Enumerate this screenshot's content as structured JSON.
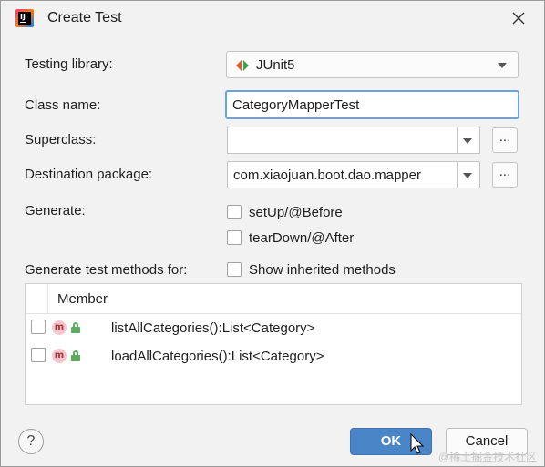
{
  "window": {
    "title": "Create Test"
  },
  "form": {
    "testing_library_label": "Testing library:",
    "testing_library_value": "JUnit5",
    "class_name_label": "Class name:",
    "class_name_value": "CategoryMapperTest",
    "superclass_label": "Superclass:",
    "superclass_value": "",
    "destination_package_label": "Destination package:",
    "destination_package_value": "com.xiaojuan.boot.dao.mapper",
    "browse_label": "...",
    "generate_label": "Generate:",
    "generate_options": [
      {
        "label": "setUp/@Before",
        "checked": false
      },
      {
        "label": "tearDown/@After",
        "checked": false
      }
    ],
    "methods_label": "Generate test methods for:",
    "show_inherited_label": "Show inherited methods"
  },
  "table": {
    "header": "Member",
    "rows": [
      {
        "method": "listAllCategories():List<Category>",
        "icon": "m"
      },
      {
        "method": "loadAllCategories():List<Category>",
        "icon": "m"
      }
    ]
  },
  "footer": {
    "help": "?",
    "ok": "OK",
    "cancel": "Cancel"
  },
  "watermark": "@稀土掘金技术社区",
  "colors": {
    "ok_button": "#4a86c7",
    "focus_border": "#6aa3dc"
  }
}
